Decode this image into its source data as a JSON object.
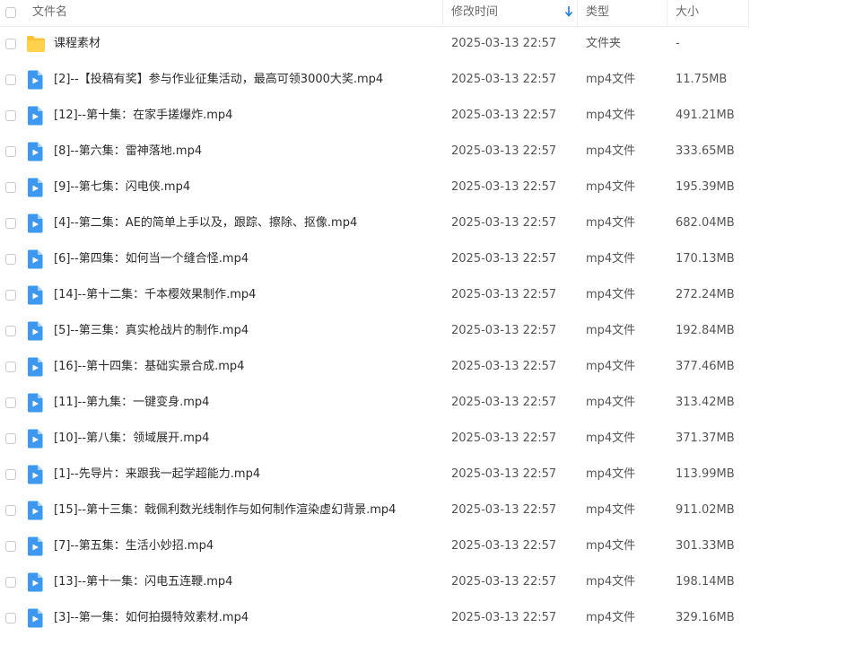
{
  "header": {
    "name": "文件名",
    "modified": "修改时间",
    "type": "类型",
    "size": "大小"
  },
  "colors": {
    "folder": "#f8c33a",
    "video": "#3d98f0",
    "sort_arrow": "#1a7ee0"
  },
  "rows": [
    {
      "icon": "folder-icon",
      "name": "课程素材",
      "time": "2025-03-13 22:57",
      "type": "文件夹",
      "size": "-"
    },
    {
      "icon": "video-file-icon",
      "name": "[2]--【投稿有奖】参与作业征集活动，最高可领3000大奖.mp4",
      "time": "2025-03-13 22:57",
      "type": "mp4文件",
      "size": "11.75MB"
    },
    {
      "icon": "video-file-icon",
      "name": "[12]--第十集：在家手搓爆炸.mp4",
      "time": "2025-03-13 22:57",
      "type": "mp4文件",
      "size": "491.21MB"
    },
    {
      "icon": "video-file-icon",
      "name": "[8]--第六集：雷神落地.mp4",
      "time": "2025-03-13 22:57",
      "type": "mp4文件",
      "size": "333.65MB"
    },
    {
      "icon": "video-file-icon",
      "name": "[9]--第七集：闪电侠.mp4",
      "time": "2025-03-13 22:57",
      "type": "mp4文件",
      "size": "195.39MB"
    },
    {
      "icon": "video-file-icon",
      "name": "[4]--第二集：AE的简单上手以及，跟踪、擦除、抠像.mp4",
      "time": "2025-03-13 22:57",
      "type": "mp4文件",
      "size": "682.04MB"
    },
    {
      "icon": "video-file-icon",
      "name": "[6]--第四集：如何当一个缝合怪.mp4",
      "time": "2025-03-13 22:57",
      "type": "mp4文件",
      "size": "170.13MB"
    },
    {
      "icon": "video-file-icon",
      "name": "[14]--第十二集：千本樱效果制作.mp4",
      "time": "2025-03-13 22:57",
      "type": "mp4文件",
      "size": "272.24MB"
    },
    {
      "icon": "video-file-icon",
      "name": "[5]--第三集：真实枪战片的制作.mp4",
      "time": "2025-03-13 22:57",
      "type": "mp4文件",
      "size": "192.84MB"
    },
    {
      "icon": "video-file-icon",
      "name": "[16]--第十四集：基础实景合成.mp4",
      "time": "2025-03-13 22:57",
      "type": "mp4文件",
      "size": "377.46MB"
    },
    {
      "icon": "video-file-icon",
      "name": "[11]--第九集：一键变身.mp4",
      "time": "2025-03-13 22:57",
      "type": "mp4文件",
      "size": "313.42MB"
    },
    {
      "icon": "video-file-icon",
      "name": "[10]--第八集：领域展开.mp4",
      "time": "2025-03-13 22:57",
      "type": "mp4文件",
      "size": "371.37MB"
    },
    {
      "icon": "video-file-icon",
      "name": "[1]--先导片：来跟我一起学超能力.mp4",
      "time": "2025-03-13 22:57",
      "type": "mp4文件",
      "size": "113.99MB"
    },
    {
      "icon": "video-file-icon",
      "name": "[15]--第十三集：戟佩利数光线制作与如何制作渲染虚幻背景.mp4",
      "time": "2025-03-13 22:57",
      "type": "mp4文件",
      "size": "911.02MB"
    },
    {
      "icon": "video-file-icon",
      "name": "[7]--第五集：生活小妙招.mp4",
      "time": "2025-03-13 22:57",
      "type": "mp4文件",
      "size": "301.33MB"
    },
    {
      "icon": "video-file-icon",
      "name": "[13]--第十一集：闪电五连鞭.mp4",
      "time": "2025-03-13 22:57",
      "type": "mp4文件",
      "size": "198.14MB"
    },
    {
      "icon": "video-file-icon",
      "name": "[3]--第一集：如何拍摄特效素材.mp4",
      "time": "2025-03-13 22:57",
      "type": "mp4文件",
      "size": "329.16MB"
    }
  ]
}
